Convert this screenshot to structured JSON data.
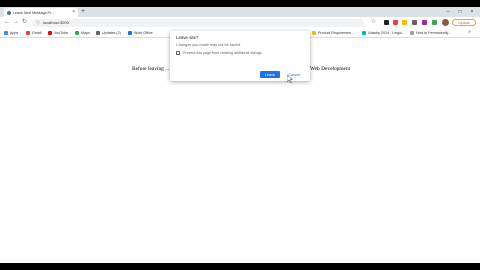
{
  "browser": {
    "tab_title": "Leave Alert Message Pr...",
    "tab_close": "×",
    "new_tab": "+",
    "window_controls": [
      "–",
      "□",
      "×"
    ],
    "url": "localhost:3000",
    "update_label": "Update"
  },
  "nav": {
    "back": "←",
    "forward": "→",
    "reload": "↻",
    "info": "ⓘ",
    "star": "☆"
  },
  "bookmarks": [
    {
      "label": "Apps",
      "icon": "apps-icon",
      "color": "#4285f4"
    },
    {
      "label": "Gmail",
      "icon": "gmail-icon",
      "color": "#ea4335"
    },
    {
      "label": "YouTube",
      "icon": "youtube-icon",
      "color": "#ff0000"
    },
    {
      "label": "Maps",
      "icon": "maps-icon",
      "color": "#34a853"
    },
    {
      "label": "Updates (2)",
      "icon": "updates-icon",
      "color": "#5f6368"
    },
    {
      "label": "Work Office",
      "icon": "work-office-icon",
      "color": "#1a73e8"
    },
    {
      "label": "Product Requiremen...",
      "icon": "document-icon",
      "color": "#fbbc04"
    },
    {
      "label": "Udacity 2024 - Lingui...",
      "icon": "udacity-icon",
      "color": "#02b3e4"
    },
    {
      "label": "How to Permanently...",
      "icon": "article-icon",
      "color": "#9aa0a6"
    }
  ],
  "bookmarks_more": "»",
  "page": {
    "text_left": "Before leaving ...",
    "text_right": "Web Development"
  },
  "dialog": {
    "title": "Leave site?",
    "message": "Changes you made may not be saved.",
    "checkbox_label": "Prevent this page from creating additional dialogs",
    "leave_label": "Leave",
    "cancel_label": "Cancel"
  }
}
